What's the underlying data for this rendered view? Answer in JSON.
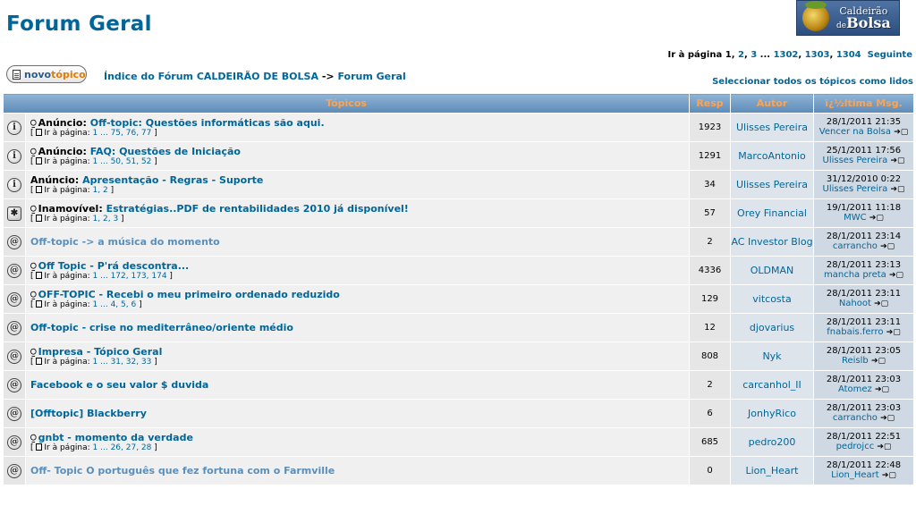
{
  "header": {
    "title": "Forum Geral",
    "logo_line1": "Caldeirão",
    "logo_line2_small": "de",
    "logo_line2": "Bolsa"
  },
  "pagination": {
    "label": "Ir à página",
    "current": "1",
    "p2": "2",
    "p3": "3",
    "ellipsis": "...",
    "p1302": "1302",
    "p1303": "1303",
    "p1304": "1304",
    "next": "Seguinte"
  },
  "new_topic": {
    "word1": "novo",
    "word2": "tópico",
    "icon": "document-icon"
  },
  "breadcrumb": {
    "index": "Índice do Fórum CALDEIRÃO DE BOLSA",
    "sep": "->",
    "current": "Forum Geral"
  },
  "mark_read": "Seleccionar todos os tópicos como lidos",
  "columns": {
    "topics": "Tópicos",
    "resp": "Resp",
    "author": "Autor",
    "last": "ï¿½ltima Msg."
  },
  "goto_label": "Ir à página:",
  "rows": [
    {
      "icon": "announcement-icon",
      "attach": true,
      "prefix": "Anúncio:",
      "title": "Off-topic: Questões informáticas são aqui.",
      "pages": "1 ... 75, 76, 77",
      "resp": "1923",
      "author": "Ulisses Pereira",
      "date": "28/1/2011 21:35",
      "poster": "Vencer na Bolsa"
    },
    {
      "icon": "announcement-icon",
      "attach": true,
      "prefix": "Anúncio:",
      "title": "FAQ: Questões de Iniciação",
      "pages": "1 ... 50, 51, 52",
      "resp": "1291",
      "author": "MarcoAntonio",
      "date": "25/1/2011 17:56",
      "poster": "Ulisses Pereira"
    },
    {
      "icon": "announcement-icon",
      "attach": false,
      "prefix": "Anúncio:",
      "title": "Apresentação - Regras - Suporte",
      "pages": "1, 2",
      "resp": "34",
      "author": "Ulisses Pereira",
      "date": "31/12/2010 0:22",
      "poster": "Ulisses Pereira"
    },
    {
      "icon": "sticky-icon",
      "attach": true,
      "prefix": "Inamovível:",
      "title": "Estratégias..PDF de rentabilidades 2010 já disponível!",
      "pages": "1, 2, 3",
      "resp": "57",
      "author": "Orey Financial",
      "date": "19/1/2011 11:18",
      "poster": "MWC"
    },
    {
      "icon": "topic-icon",
      "attach": false,
      "prefix": "",
      "title": "Off-topic -> a música do momento",
      "pages": "",
      "resp": "2",
      "author": "AC Investor Blog",
      "date": "28/1/2011 23:14",
      "poster": "carrancho",
      "read": true
    },
    {
      "icon": "topic-icon",
      "attach": true,
      "prefix": "",
      "title": "Off Topic - P'rá descontra...",
      "pages": "1 ... 172, 173, 174",
      "resp": "4336",
      "author": "OLDMAN",
      "date": "28/1/2011 23:13",
      "poster": "mancha preta"
    },
    {
      "icon": "topic-icon",
      "attach": true,
      "prefix": "",
      "title": "OFF-TOPIC - Recebi o meu primeiro ordenado reduzido",
      "pages": "1 ... 4, 5, 6",
      "resp": "129",
      "author": "vitcosta",
      "date": "28/1/2011 23:11",
      "poster": "Nahoot"
    },
    {
      "icon": "topic-icon",
      "attach": false,
      "prefix": "",
      "title": "Off-topic - crise no mediterrâneo/oriente médio",
      "pages": "",
      "resp": "12",
      "author": "djovarius",
      "date": "28/1/2011 23:11",
      "poster": "fnabais.ferro"
    },
    {
      "icon": "topic-icon",
      "attach": true,
      "prefix": "",
      "title": "Impresa - Tópico Geral",
      "pages": "1 ... 31, 32, 33",
      "resp": "808",
      "author": "Nyk",
      "date": "28/1/2011 23:05",
      "poster": "Reislb"
    },
    {
      "icon": "topic-icon",
      "attach": false,
      "prefix": "",
      "title": "Facebook e o seu valor $ duvida",
      "pages": "",
      "resp": "2",
      "author": "carcanhol_II",
      "date": "28/1/2011 23:03",
      "poster": "Atomez"
    },
    {
      "icon": "topic-icon",
      "attach": false,
      "prefix": "",
      "title": "[Offtopic] Blackberry",
      "pages": "",
      "resp": "6",
      "author": "JonhyRico",
      "date": "28/1/2011 23:03",
      "poster": "carrancho"
    },
    {
      "icon": "topic-icon",
      "attach": true,
      "prefix": "",
      "title": "gnbt - momento da verdade",
      "pages": "1 ... 26, 27, 28",
      "resp": "685",
      "author": "pedro200",
      "date": "28/1/2011 22:51",
      "poster": "pedrojcc"
    },
    {
      "icon": "topic-icon",
      "attach": false,
      "prefix": "",
      "title": "Off- Topic O português que fez fortuna com o Farmville",
      "pages": "",
      "resp": "0",
      "author": "Lion_Heart",
      "date": "28/1/2011 22:48",
      "poster": "Lion_Heart",
      "read": true
    }
  ]
}
